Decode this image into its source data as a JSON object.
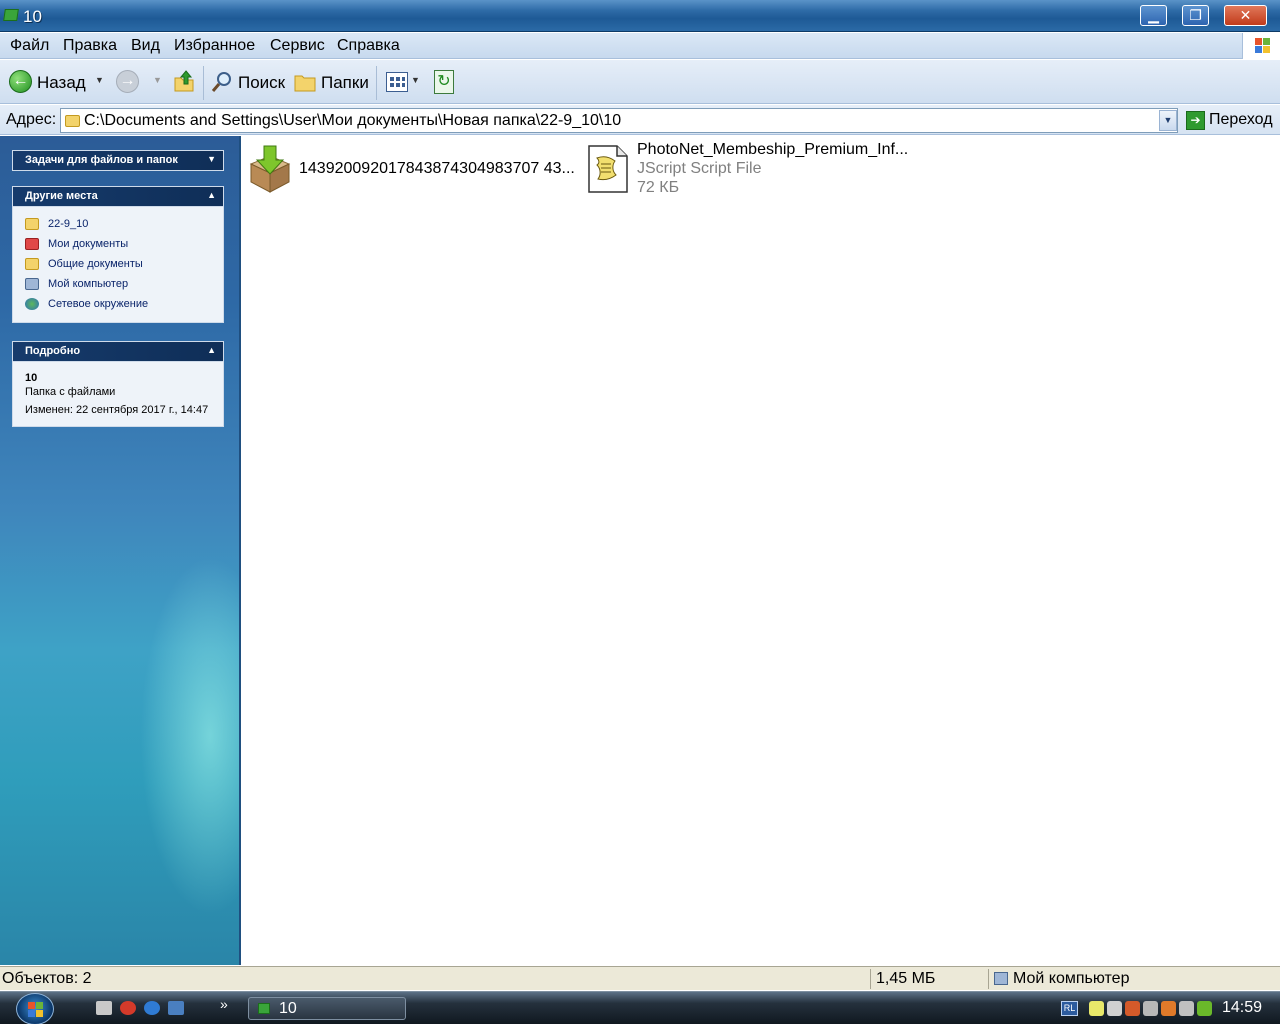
{
  "window": {
    "title": "10",
    "minimize_symbol": "▁",
    "maximize_symbol": "❐",
    "close_symbol": "✕"
  },
  "menu": {
    "items": [
      "Файл",
      "Правка",
      "Вид",
      "Избранное",
      "Сервис",
      "Справка"
    ]
  },
  "toolbar": {
    "back_label": "Назад",
    "search_label": "Поиск",
    "folders_label": "Папки"
  },
  "address": {
    "label": "Адрес:",
    "path": "C:\\Documents and Settings\\User\\Мои документы\\Новая папка\\22-9_10\\10",
    "go_label": "Переход"
  },
  "sidebar": {
    "tasks_header": "Задачи для файлов и папок",
    "places_header": "Другие места",
    "places": [
      {
        "label": "22-9_10",
        "icon": "folder-icon"
      },
      {
        "label": "Мои документы",
        "icon": "my-documents-icon"
      },
      {
        "label": "Общие документы",
        "icon": "folder-icon"
      },
      {
        "label": "Мой компьютер",
        "icon": "computer-icon"
      },
      {
        "label": "Сетевое окружение",
        "icon": "network-icon"
      }
    ],
    "details_header": "Подробно",
    "details": {
      "name": "10",
      "type": "Папка с файлами",
      "modified": "Изменен: 22 сентября 2017 г., 14:47"
    }
  },
  "files": [
    {
      "name": "143920092017843874304983707 43...",
      "icon": "package-download-icon"
    },
    {
      "name": "PhotoNet_Membeship_Premium_Inf...",
      "type": "JScript Script File",
      "size": "72 КБ",
      "icon": "jscript-file-icon"
    }
  ],
  "status": {
    "count": "Объектов: 2",
    "size": "1,45 МБ",
    "location": "Мой компьютер"
  },
  "taskbar": {
    "task_title": "10",
    "language": "RL",
    "clock": "14:59",
    "overflow": "»"
  },
  "colors": {
    "titlebar": "#2d6aa6",
    "sidebar": "#3f86bc",
    "panel_header": "#163b6c",
    "taskbar": "#101820"
  }
}
